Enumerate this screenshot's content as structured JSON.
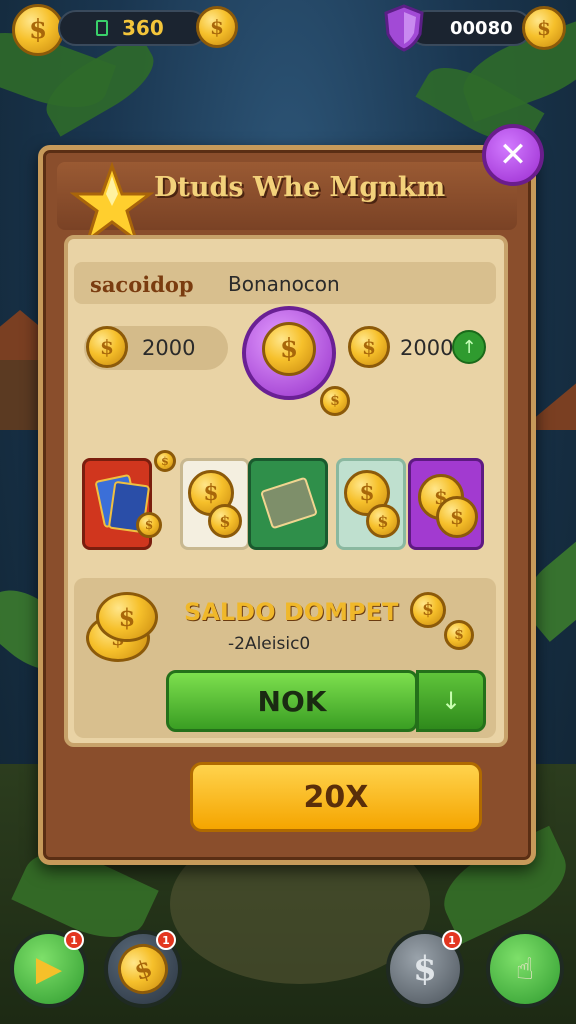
{
  "top_bar": {
    "left_value": "360",
    "right_value": "00080"
  },
  "dialog": {
    "title": "Dtuds Whe Mgnkm",
    "close_label": "✕",
    "row_label_left": "sacoidop",
    "row_label_right": "Bonanocon",
    "amount_left": "2000",
    "amount_right": "2000",
    "wallet_title": "SALDO DOMPET",
    "wallet_subtitle": "-2Aleisic0",
    "ok_label": "NOK",
    "main_button_label": "20X"
  },
  "bottom_nav": {
    "badge_1": "1",
    "badge_2": "1",
    "badge_3": "1"
  },
  "colors": {
    "accent": "#f5a500",
    "dialog_wood": "#8a4e2c",
    "panel": "#e9d3a5",
    "ok_green": "#3a9e23",
    "close_purple": "#9b2dd0"
  }
}
